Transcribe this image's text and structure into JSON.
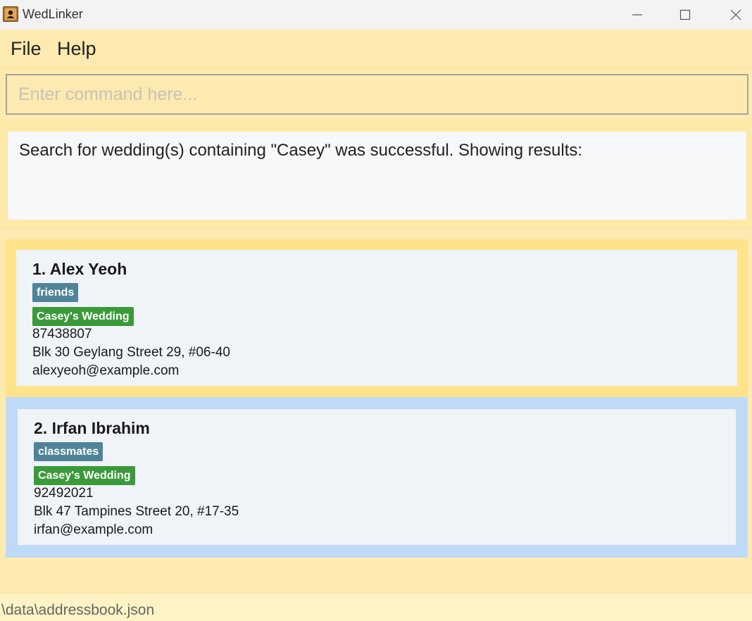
{
  "window": {
    "title": "WedLinker",
    "icon": "address-book-icon",
    "controls": [
      "minimize-icon",
      "maximize-icon",
      "close-icon"
    ]
  },
  "menu": {
    "file": "File",
    "help": "Help"
  },
  "command": {
    "placeholder": "Enter command here...",
    "value": ""
  },
  "result": {
    "message": "Search for wedding(s) containing \"Casey\" was successful. Showing results:"
  },
  "persons": [
    {
      "index_name": "1. Alex Yeoh",
      "tag": "friends",
      "wedding": "Casey's Wedding",
      "phone": "87438807",
      "address": "Blk 30 Geylang Street 29, #06-40",
      "email": "alexyeoh@example.com",
      "selected": true
    },
    {
      "index_name": "2. Irfan Ibrahim",
      "tag": "classmates",
      "wedding": "Casey's Wedding",
      "phone": "92492021",
      "address": "Blk 47 Tampines Street 20, #17-35",
      "email": "irfan@example.com",
      "selected": false
    }
  ],
  "status": {
    "path": "\\data\\addressbook.json"
  },
  "colors": {
    "background": "#fdeab0",
    "selected_row": "#fde48a",
    "alt_row": "#bfdaf7",
    "tag_blue": "#4f8498",
    "tag_green": "#3a9a3a"
  }
}
